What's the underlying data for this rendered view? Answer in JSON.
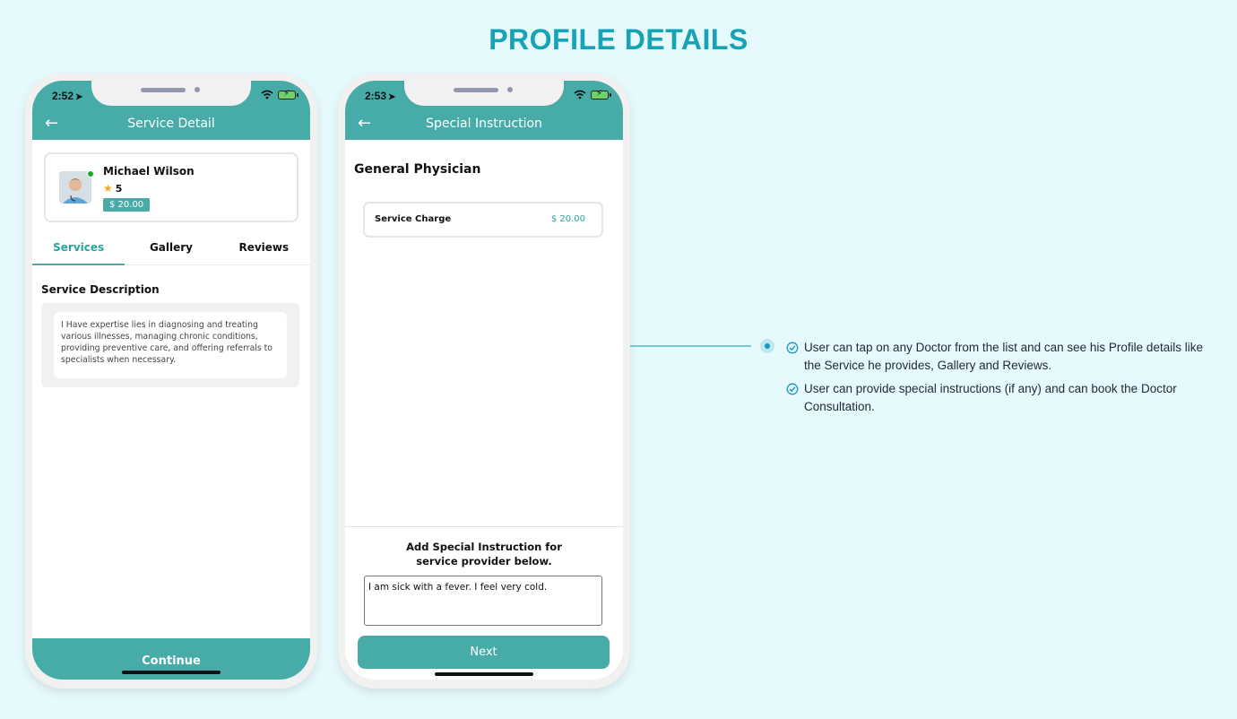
{
  "page": {
    "title": "PROFILE DETAILS"
  },
  "colors": {
    "accent": "#47aca8",
    "title": "#17a3b5",
    "background": "#e6f9fc"
  },
  "phone1": {
    "status_time": "2:52",
    "header_title": "Service Detail",
    "doctor": {
      "name": "Michael Wilson",
      "rating": "5",
      "price": "$ 20.00"
    },
    "tabs": [
      {
        "label": "Services",
        "active": true
      },
      {
        "label": "Gallery",
        "active": false
      },
      {
        "label": "Reviews",
        "active": false
      }
    ],
    "section_label": "Service Description",
    "description": "I Have expertise lies in diagnosing and treating various illnesses, managing chronic conditions, providing preventive care, and offering referrals to specialists when necessary.",
    "continue_label": "Continue"
  },
  "phone2": {
    "status_time": "2:53",
    "header_title": "Special Instruction",
    "category_title": "General Physician",
    "charge_label": "Service Charge",
    "charge_value": "$ 20.00",
    "instruction_label": "Add Special Instruction for service provider below.",
    "instruction_value": "I am sick with a fever. I feel very cold.",
    "next_label": "Next"
  },
  "notes": [
    "User can tap on any Doctor from the list and can see his Profile details like the Service he provides, Gallery and Reviews.",
    "User can provide special instructions (if any) and can book the Doctor Consultation."
  ]
}
